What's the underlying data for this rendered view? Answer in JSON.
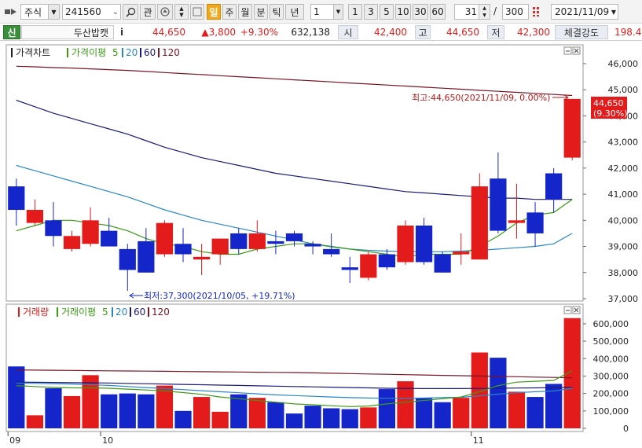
{
  "toolbar": {
    "market": "주식",
    "code": "241560",
    "btn_watch": "관",
    "period_tabs": [
      "일",
      "주",
      "월",
      "분",
      "틱",
      "년"
    ],
    "active_period": "일",
    "period_select": "1",
    "period_nums": [
      "1",
      "3",
      "5",
      "10",
      "30",
      "60"
    ],
    "count_value": "31",
    "slash": "/",
    "total_value": "300",
    "date_value": "2021/11/09"
  },
  "quote": {
    "market_tag": "신",
    "name": "두산밥캣",
    "info_icon": "i",
    "price": "44,650",
    "change": "▲3,800",
    "change_pct": "+9.30%",
    "volume": "632,138",
    "open_label": "시",
    "open": "42,400",
    "high_label": "고",
    "high": "44,650",
    "low_label": "저",
    "low": "42,300",
    "strength_label": "체결강도",
    "strength": "198.4"
  },
  "legend_price": {
    "title": "가격차트",
    "ma_label": "가격이평",
    "ma_values": [
      "5",
      "20",
      "60",
      "120"
    ]
  },
  "legend_volume": {
    "title": "거래량",
    "ma_label": "거래이평",
    "ma_values": [
      "5",
      "20",
      "60",
      "120"
    ]
  },
  "colors": {
    "up": "#e31b1b",
    "down": "#1426c9",
    "ma5": "#3c9a17",
    "ma20": "#2a86c8",
    "ma60": "#1a1a7a",
    "ma120": "#7a1426"
  },
  "annotations": {
    "high": "최고:44,650(2021/11/09, 0.00%)",
    "low": "최저:37,300(2021/10/05, +19.71%)",
    "last_price": "44,650",
    "last_pct": "(9.30%)"
  },
  "chart_data": {
    "type": "candlestick",
    "x_labels": [
      "09",
      "10",
      "11"
    ],
    "price_ticks": [
      "37,000",
      "38,000",
      "39,000",
      "40,000",
      "41,000",
      "42,000",
      "43,000",
      "44,000",
      "45,000",
      "46,000"
    ],
    "price_ylim": [
      37000,
      46300
    ],
    "volume_ticks": [
      "0",
      "100,000",
      "200,000",
      "300,000",
      "400,000",
      "500,000",
      "600,000"
    ],
    "volume_ylim": [
      0,
      640000
    ],
    "candles": [
      {
        "o": 41300,
        "h": 41600,
        "l": 39800,
        "c": 40400,
        "v": 355000
      },
      {
        "o": 39900,
        "h": 40800,
        "l": 39800,
        "c": 40400,
        "v": 75000
      },
      {
        "o": 40000,
        "h": 40700,
        "l": 39000,
        "c": 39400,
        "v": 230000
      },
      {
        "o": 38900,
        "h": 39600,
        "l": 38800,
        "c": 39400,
        "v": 185000
      },
      {
        "o": 39100,
        "h": 40500,
        "l": 39000,
        "c": 40000,
        "v": 305000
      },
      {
        "o": 39600,
        "h": 40100,
        "l": 39000,
        "c": 39000,
        "v": 195000
      },
      {
        "o": 38900,
        "h": 39100,
        "l": 37300,
        "c": 38100,
        "v": 200000
      },
      {
        "o": 39200,
        "h": 39700,
        "l": 38000,
        "c": 38000,
        "v": 195000
      },
      {
        "o": 38700,
        "h": 40000,
        "l": 38600,
        "c": 39900,
        "v": 245000
      },
      {
        "o": 39100,
        "h": 39700,
        "l": 38400,
        "c": 38700,
        "v": 100000
      },
      {
        "o": 38500,
        "h": 39100,
        "l": 37900,
        "c": 38600,
        "v": 180000
      },
      {
        "o": 38700,
        "h": 39300,
        "l": 38300,
        "c": 39300,
        "v": 95000
      },
      {
        "o": 39500,
        "h": 39700,
        "l": 38700,
        "c": 38900,
        "v": 195000
      },
      {
        "o": 38900,
        "h": 40000,
        "l": 38800,
        "c": 39500,
        "v": 175000
      },
      {
        "o": 39200,
        "h": 39600,
        "l": 38700,
        "c": 39100,
        "v": 150000
      },
      {
        "o": 39500,
        "h": 39600,
        "l": 39000,
        "c": 39200,
        "v": 85000
      },
      {
        "o": 39100,
        "h": 39200,
        "l": 38700,
        "c": 39000,
        "v": 130000
      },
      {
        "o": 38900,
        "h": 39500,
        "l": 38600,
        "c": 38700,
        "v": 115000
      },
      {
        "o": 38200,
        "h": 38600,
        "l": 37600,
        "c": 38100,
        "v": 110000
      },
      {
        "o": 37800,
        "h": 38800,
        "l": 37700,
        "c": 38700,
        "v": 120000
      },
      {
        "o": 38700,
        "h": 38900,
        "l": 38100,
        "c": 38200,
        "v": 225000
      },
      {
        "o": 38400,
        "h": 40000,
        "l": 38300,
        "c": 39800,
        "v": 270000
      },
      {
        "o": 39800,
        "h": 40100,
        "l": 38300,
        "c": 38400,
        "v": 175000
      },
      {
        "o": 38700,
        "h": 38800,
        "l": 38000,
        "c": 38000,
        "v": 150000
      },
      {
        "o": 38700,
        "h": 39500,
        "l": 38300,
        "c": 38800,
        "v": 175000
      },
      {
        "o": 38500,
        "h": 41800,
        "l": 38500,
        "c": 41300,
        "v": 435000
      },
      {
        "o": 41600,
        "h": 42600,
        "l": 39500,
        "c": 39600,
        "v": 405000
      },
      {
        "o": 39900,
        "h": 41400,
        "l": 39300,
        "c": 40000,
        "v": 210000
      },
      {
        "o": 40300,
        "h": 40700,
        "l": 39000,
        "c": 39500,
        "v": 180000
      },
      {
        "o": 41800,
        "h": 42000,
        "l": 40300,
        "c": 40800,
        "v": 255000
      },
      {
        "o": 42400,
        "h": 44650,
        "l": 42300,
        "c": 44650,
        "v": 632138
      }
    ],
    "ma5": [
      39600,
      39800,
      40000,
      40000,
      39900,
      39800,
      39600,
      39300,
      39100,
      39000,
      38800,
      38700,
      38700,
      38900,
      39000,
      39100,
      39100,
      39000,
      38900,
      38800,
      38700,
      38600,
      38700,
      38700,
      38700,
      39000,
      39400,
      39900,
      40200,
      40300,
      40800
    ],
    "ma20": [
      42100,
      41900,
      41700,
      41500,
      41300,
      41100,
      40900,
      40650,
      40400,
      40200,
      40000,
      39850,
      39700,
      39550,
      39400,
      39250,
      39100,
      38980,
      38900,
      38850,
      38820,
      38800,
      38800,
      38800,
      38820,
      38850,
      38900,
      38950,
      39000,
      39100,
      39500
    ],
    "ma60": [
      44600,
      44350,
      44100,
      43900,
      43700,
      43500,
      43300,
      43050,
      42800,
      42600,
      42400,
      42250,
      42100,
      41950,
      41800,
      41700,
      41600,
      41500,
      41400,
      41300,
      41200,
      41100,
      41050,
      41000,
      40950,
      40900,
      40850,
      40850,
      40800,
      40800,
      40800
    ],
    "ma120": [
      45900,
      45880,
      45850,
      45830,
      45800,
      45770,
      45740,
      45700,
      45660,
      45620,
      45580,
      45540,
      45500,
      45460,
      45420,
      45380,
      45340,
      45300,
      45260,
      45220,
      45180,
      45140,
      45100,
      45060,
      45020,
      44980,
      44940,
      44900,
      44860,
      44820,
      44780
    ],
    "vma5": [
      245000,
      240000,
      235000,
      232000,
      232000,
      230000,
      225000,
      220000,
      215000,
      205000,
      195000,
      180000,
      170000,
      160000,
      150000,
      140000,
      135000,
      130000,
      125000,
      128000,
      140000,
      150000,
      160000,
      170000,
      180000,
      210000,
      245000,
      265000,
      270000,
      275000,
      330000
    ],
    "vma20": [
      260000,
      258000,
      256000,
      254000,
      250000,
      246000,
      240000,
      234000,
      228000,
      222000,
      216000,
      210000,
      204000,
      198000,
      192000,
      188000,
      184000,
      180000,
      176000,
      174000,
      172000,
      172000,
      174000,
      176000,
      178000,
      186000,
      196000,
      204000,
      210000,
      214000,
      230000
    ],
    "vma60": [
      265000,
      264000,
      263000,
      262000,
      261000,
      260000,
      258000,
      256000,
      254000,
      252000,
      250000,
      248000,
      246000,
      244000,
      242000,
      240000,
      238000,
      236000,
      234000,
      232000,
      230000,
      229000,
      228000,
      228000,
      228000,
      229000,
      230000,
      231000,
      232000,
      233000,
      236000
    ],
    "vma120": [
      335000,
      334000,
      333000,
      332000,
      331000,
      330000,
      329000,
      328000,
      327000,
      326000,
      325000,
      324000,
      323000,
      322000,
      321000,
      320000,
      318000,
      316000,
      314000,
      312000,
      310000,
      308000,
      306000,
      304000,
      302000,
      300000,
      298000,
      296000,
      294000,
      292000,
      290000
    ]
  }
}
